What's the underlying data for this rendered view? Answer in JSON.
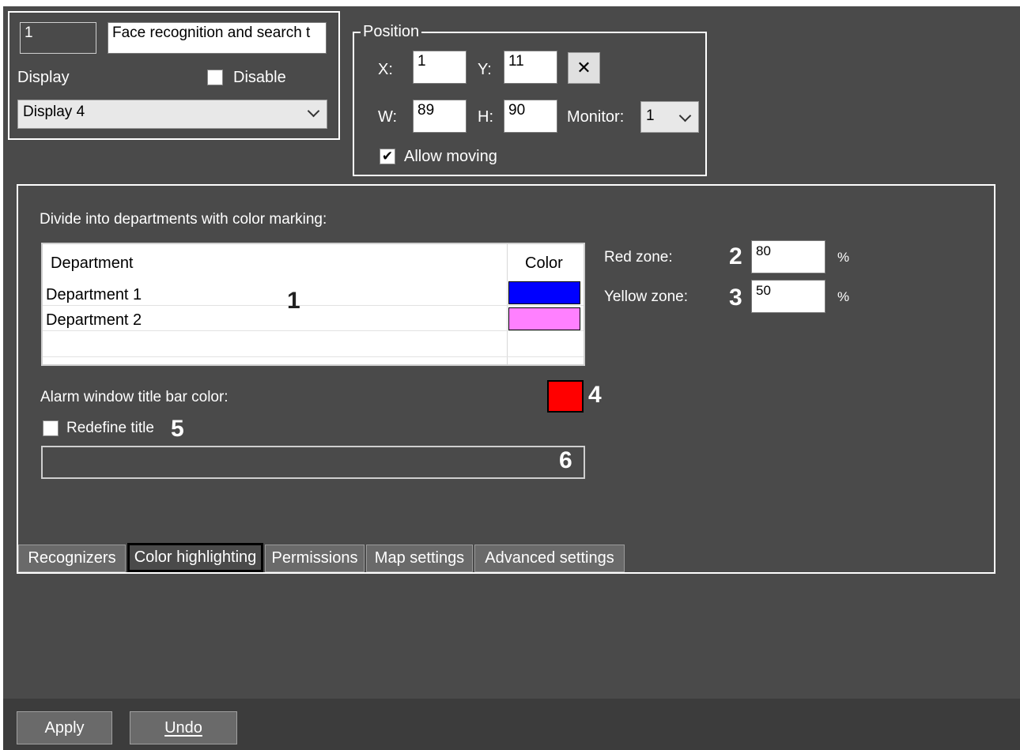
{
  "window": {
    "id_value": "1",
    "name_value": "Face recognition and search t",
    "display_label": "Display",
    "disable_label": "Disable",
    "display_select": "Display 4"
  },
  "position": {
    "title": "Position",
    "x_label": "X:",
    "x_value": "1",
    "y_label": "Y:",
    "y_value": "11",
    "clear_glyph": "✕",
    "w_label": "W:",
    "w_value": "89",
    "h_label": "H:",
    "h_value": "90",
    "monitor_label": "Monitor:",
    "monitor_value": "1",
    "allow_moving_label": "Allow moving",
    "allow_moving_checked": true
  },
  "color_highlighting": {
    "heading": "Divide into departments with color marking:",
    "table": {
      "headers": [
        "Department",
        "Color"
      ],
      "rows": [
        {
          "department": "Department 1",
          "color": "#0000ff"
        },
        {
          "department": "Department 2",
          "color": "#ff80ff"
        }
      ]
    },
    "red_zone_label": "Red zone:",
    "red_zone_value": "80",
    "yellow_zone_label": "Yellow zone:",
    "yellow_zone_value": "50",
    "percent_sign": "%",
    "alarm_title_color_label": "Alarm window title bar color:",
    "alarm_title_color": "#ff0000",
    "redefine_title_label": "Redefine title",
    "redefine_title_checked": false,
    "title_input_value": ""
  },
  "callouts": [
    "1",
    "2",
    "3",
    "4",
    "5",
    "6"
  ],
  "tabs": [
    {
      "label": "Recognizers",
      "active": false
    },
    {
      "label": "Color highlighting",
      "active": true
    },
    {
      "label": "Permissions",
      "active": false
    },
    {
      "label": "Map settings",
      "active": false
    },
    {
      "label": "Advanced settings",
      "active": false
    }
  ],
  "buttons": {
    "apply": "Apply",
    "undo": "Undo"
  }
}
